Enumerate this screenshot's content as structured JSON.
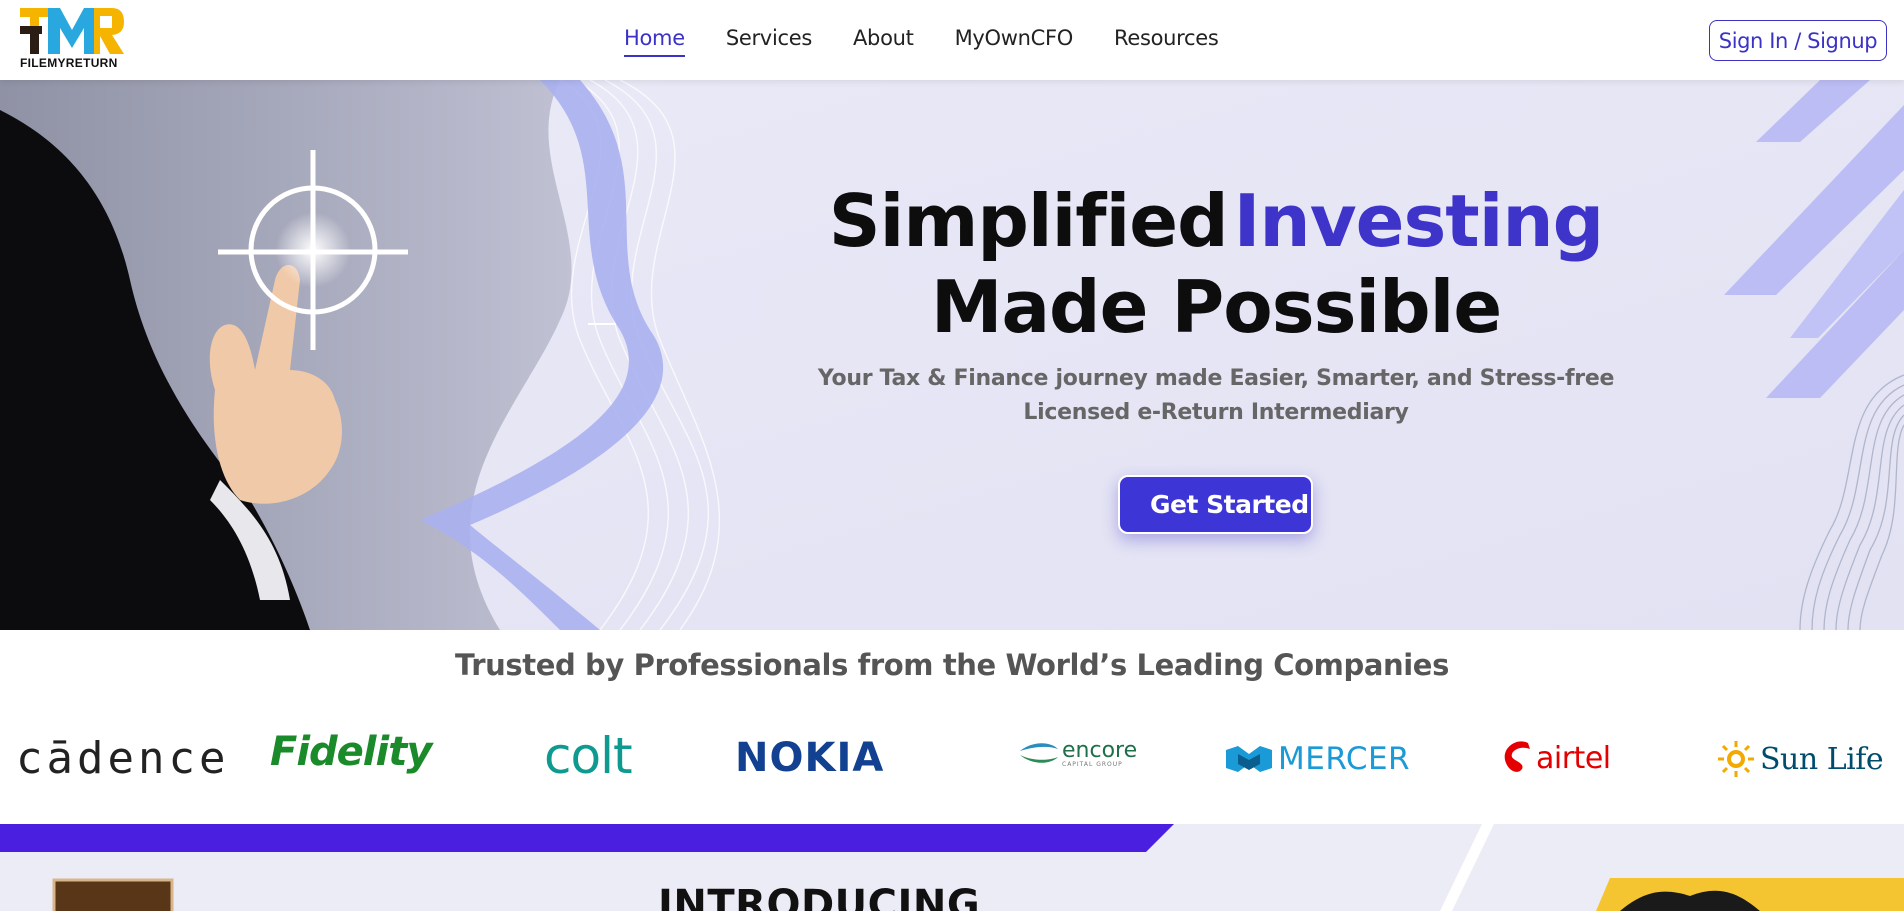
{
  "header": {
    "logo_text": "FILEMYRETURN",
    "nav": [
      {
        "label": "Home",
        "active": true
      },
      {
        "label": "Services",
        "active": false
      },
      {
        "label": "About",
        "active": false
      },
      {
        "label": "MyOwnCFO",
        "active": false
      },
      {
        "label": "Resources",
        "active": false
      }
    ],
    "signin_label": "Sign In / Signup"
  },
  "hero": {
    "headline_part1": "Simplified",
    "headline_accent": "Investing",
    "headline_line2": "Made Possible",
    "sub_line1": "Your Tax & Finance journey made Easier, Smarter, and Stress-free",
    "sub_line2": "Licensed e-Return Intermediary",
    "cta_label": "Get Started"
  },
  "trusted": {
    "title": "Trusted by Professionals from the World’s Leading Companies",
    "brands": [
      {
        "name": "cādence",
        "color": "#222222"
      },
      {
        "name": "Fidelity",
        "color": "#1a8a2a"
      },
      {
        "name": "colt",
        "color": "#0e9a8e"
      },
      {
        "name": "NOKIA",
        "color": "#124191"
      },
      {
        "name": "encore",
        "sub": "CAPITAL GROUP",
        "color": "#1f6f4a"
      },
      {
        "name": "MERCER",
        "color": "#1a9ad6"
      },
      {
        "name": "airtel",
        "color": "#e40000"
      },
      {
        "name": "Sun Life",
        "color": "#004c6c"
      }
    ]
  },
  "section2": {
    "heading": "INTRODUCING"
  },
  "colors": {
    "accent": "#3e34c9",
    "hero_bg": "#e6e6f6"
  }
}
